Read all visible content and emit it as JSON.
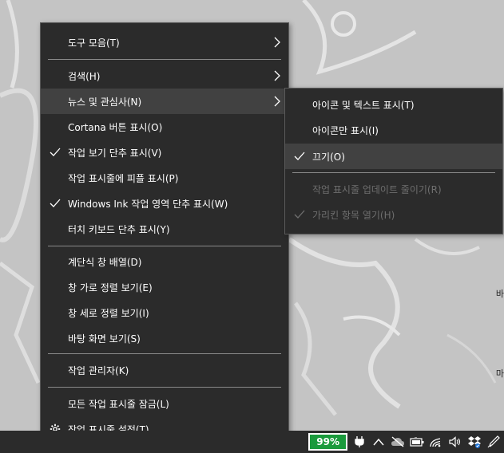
{
  "main_menu": {
    "items": [
      {
        "label": "도구 모음(T)"
      },
      {
        "label": "검색(H)"
      },
      {
        "label": "뉴스 및 관심사(N)"
      },
      {
        "label": "Cortana 버튼 표시(O)"
      },
      {
        "label": "작업 보기 단추 표시(V)"
      },
      {
        "label": "작업 표시줄에 피플 표시(P)"
      },
      {
        "label": "Windows Ink 작업 영역 단추 표시(W)"
      },
      {
        "label": "터치 키보드 단추 표시(Y)"
      },
      {
        "label": "계단식 창 배열(D)"
      },
      {
        "label": "창 가로 정렬 보기(E)"
      },
      {
        "label": "창 세로 정렬 보기(I)"
      },
      {
        "label": "바탕 화면 보기(S)"
      },
      {
        "label": "작업 관리자(K)"
      },
      {
        "label": "모든 작업 표시줄 잠금(L)"
      },
      {
        "label": "작업 표시줄 설정(T)"
      }
    ]
  },
  "sub_menu": {
    "items": [
      {
        "label": "아이콘 및 텍스트 표시(T)"
      },
      {
        "label": "아이콘만 표시(I)"
      },
      {
        "label": "끄기(O)"
      },
      {
        "label": "작업 표시줄 업데이트 줄이기(R)"
      },
      {
        "label": "가리킨 항목 열기(H)"
      }
    ]
  },
  "taskbar": {
    "battery_percent": "99%",
    "tray_icons": [
      "power-plug-icon",
      "chevron-up-icon",
      "cloud-offline-icon",
      "battery-icon",
      "wifi-icon",
      "volume-icon",
      "dropbox-icon",
      "pen-icon"
    ]
  },
  "desktop": {
    "edge_text_1": "바",
    "edge_text_2": "마"
  },
  "colors": {
    "menu_bg": "#2b2b2b",
    "menu_hover": "#414141",
    "battery_green": "#1a9a3c"
  }
}
